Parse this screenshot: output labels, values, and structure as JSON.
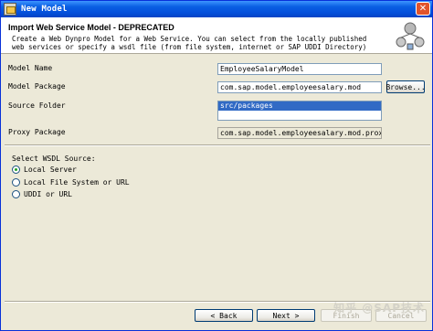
{
  "window": {
    "title": "New Model",
    "close_glyph": "✕"
  },
  "header": {
    "title": "Import Web Service Model - DEPRECATED",
    "description": "Create a Web Dynpro Model for a Web Service. You can select from the locally published web services or specify a wsdl file (from file system, internet or SAP UDDI Directory)"
  },
  "form": {
    "model_name": {
      "label": "Model Name",
      "value": "EmployeeSalaryModel"
    },
    "model_package": {
      "label": "Model Package",
      "value": "com.sap.model.employeesalary.mod",
      "browse": "Browse..."
    },
    "source_folder": {
      "label": "Source Folder",
      "value": "src/packages"
    },
    "proxy_package": {
      "label": "Proxy Package",
      "value": "com.sap.model.employeesalary.mod.proxies"
    }
  },
  "wsdl_source": {
    "label": "Select WSDL Source:",
    "options": [
      {
        "label": "Local Server",
        "selected": true
      },
      {
        "label": "Local File System or URL",
        "selected": false
      },
      {
        "label": "UDDI or URL",
        "selected": false
      }
    ]
  },
  "buttons": {
    "back": "< Back",
    "next": "Next >",
    "finish": "Finish",
    "cancel": "Cancel"
  },
  "watermark": "知乎 @SAP技术",
  "colors": {
    "titlebar": "#0450dc",
    "selection": "#316ac5",
    "dialog_bg": "#ece9d8"
  }
}
